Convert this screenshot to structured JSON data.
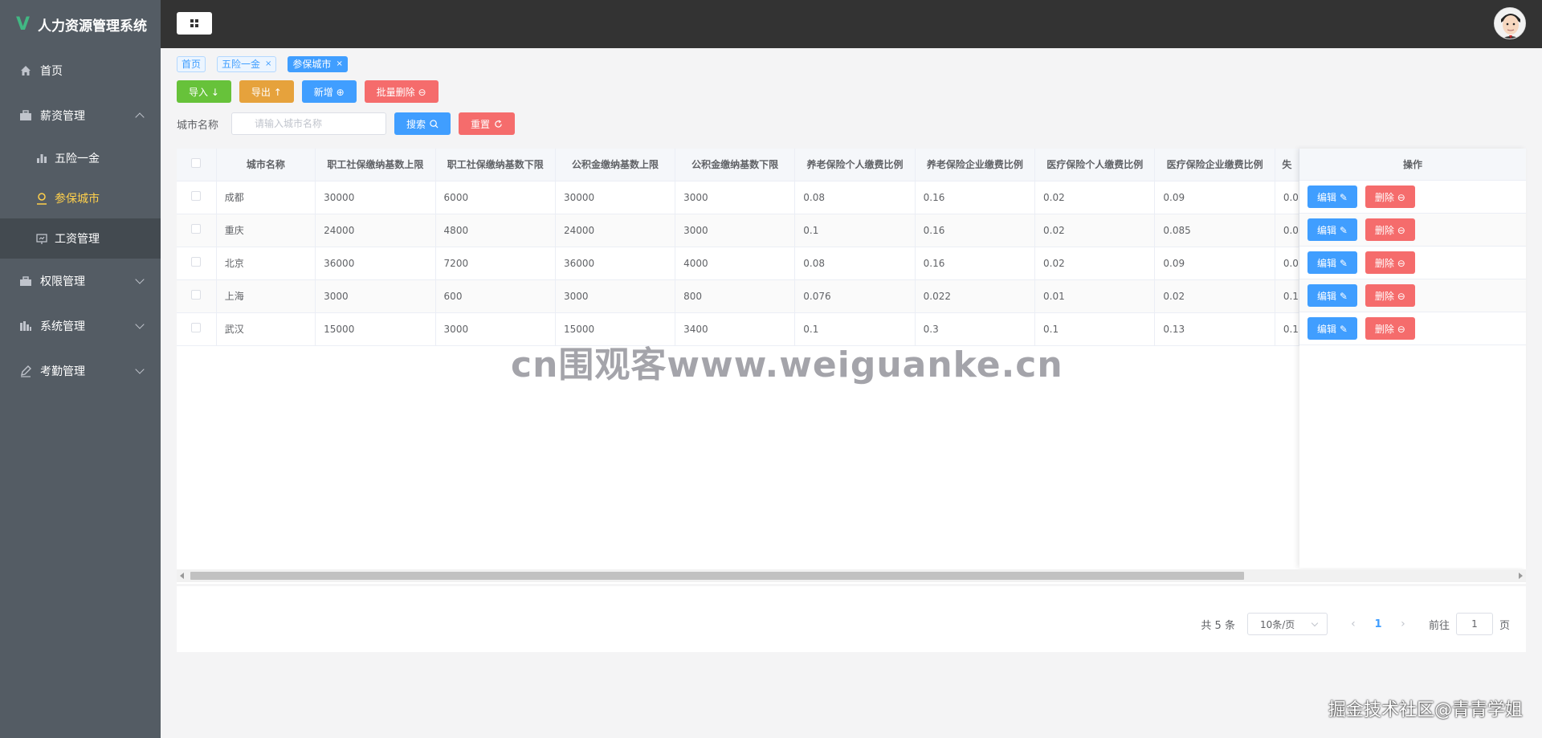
{
  "app": {
    "title": "人力资源管理系统",
    "logo_letter": "V"
  },
  "sidebar": {
    "home": "首页",
    "salary": {
      "label": "薪资管理",
      "items": [
        "五险一金",
        "参保城市",
        "工资管理"
      ]
    },
    "permission": "权限管理",
    "system": "系统管理",
    "attendance": "考勤管理"
  },
  "tags": [
    {
      "label": "首页"
    },
    {
      "label": "五险一金",
      "close": "×"
    },
    {
      "label": "参保城市",
      "close": "×"
    }
  ],
  "toolbar": {
    "import": "导入 ↓",
    "export": "导出 ↑",
    "add": "新增 ⊕",
    "batch_delete": "批量删除 ⊖"
  },
  "search": {
    "label": "城市名称",
    "placeholder": "请输入城市名称",
    "search_btn": "搜索",
    "reset_btn": "重置"
  },
  "table": {
    "columns": [
      "城市名称",
      "职工社保缴纳基数上限",
      "职工社保缴纳基数下限",
      "公积金缴纳基数上限",
      "公积金缴纳基数下限",
      "养老保险个人缴费比例",
      "养老保险企业缴费比例",
      "医疗保险个人缴费比例",
      "医疗保险企业缴费比例",
      "失"
    ],
    "rows": [
      [
        "成都",
        "30000",
        "6000",
        "30000",
        "3000",
        "0.08",
        "0.16",
        "0.02",
        "0.09",
        "0.0"
      ],
      [
        "重庆",
        "24000",
        "4800",
        "24000",
        "3000",
        "0.1",
        "0.16",
        "0.02",
        "0.085",
        "0.0"
      ],
      [
        "北京",
        "36000",
        "7200",
        "36000",
        "4000",
        "0.08",
        "0.16",
        "0.02",
        "0.09",
        "0.0"
      ],
      [
        "上海",
        "3000",
        "600",
        "3000",
        "800",
        "0.076",
        "0.022",
        "0.01",
        "0.02",
        "0.1"
      ],
      [
        "武汉",
        "15000",
        "3000",
        "15000",
        "3400",
        "0.1",
        "0.3",
        "0.1",
        "0.13",
        "0.1"
      ]
    ],
    "action_header": "操作",
    "edit_label": "编辑 ✎",
    "delete_label": "删除 ⊖"
  },
  "pagination": {
    "total": "共 5 条",
    "page_size": "10条/页",
    "prev": "‹",
    "next": "›",
    "current": "1",
    "goto_prefix": "前往",
    "goto_value": "1",
    "goto_suffix": "页"
  },
  "overlay": {
    "watermark": "cn围观客www.weiguanke.cn",
    "credit": "掘金技术社区@青青学姐"
  },
  "colors": {
    "primary": "#409eff",
    "success": "#67c23a",
    "warning": "#e6a23c",
    "danger": "#f56c6c",
    "sidebar": "#545c64",
    "active_menu": "#ffd04b"
  }
}
